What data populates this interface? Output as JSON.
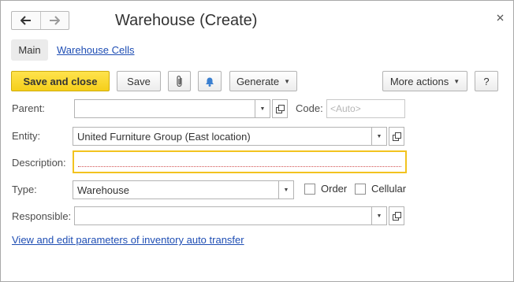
{
  "window": {
    "title": "Warehouse (Create)",
    "close_icon": "close-icon"
  },
  "nav": {
    "back_icon": "arrow-left-icon",
    "forward_icon": "arrow-right-icon"
  },
  "tabs": [
    {
      "label": "Main",
      "active": true
    },
    {
      "label": "Warehouse Cells",
      "active": false
    }
  ],
  "toolbar": {
    "save_close_label": "Save and close",
    "save_label": "Save",
    "attach_icon": "paperclip-icon",
    "notify_icon": "bell-icon",
    "generate_label": "Generate",
    "more_actions_label": "More actions",
    "help_label": "?"
  },
  "form": {
    "parent": {
      "label": "Parent:",
      "value": ""
    },
    "code": {
      "label": "Code:",
      "placeholder": "<Auto>"
    },
    "entity": {
      "label": "Entity:",
      "value": "United Furniture Group (East location)"
    },
    "description": {
      "label": "Description:",
      "value": ""
    },
    "type": {
      "label": "Type:",
      "value": "Warehouse"
    },
    "order": {
      "label": "Order",
      "checked": false
    },
    "cellular": {
      "label": "Cellular",
      "checked": false
    },
    "responsible": {
      "label": "Responsible:",
      "value": ""
    }
  },
  "bottom_link": "View and edit parameters of inventory auto transfer",
  "colors": {
    "accent_yellow": "#f5cf1a",
    "link_blue": "#1f4eb4",
    "focus_border": "#f2c31f"
  }
}
